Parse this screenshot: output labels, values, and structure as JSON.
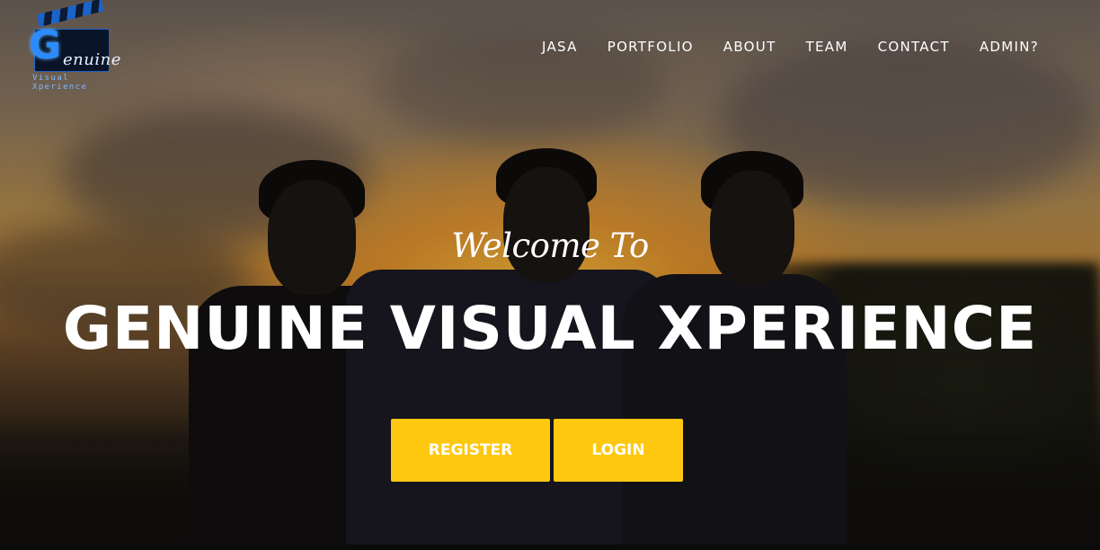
{
  "brand": {
    "logo_letter": "G",
    "logo_word": "enuine",
    "logo_subtitle": "Visual Xperience"
  },
  "nav": {
    "items": [
      {
        "label": "JASA"
      },
      {
        "label": "PORTFOLIO"
      },
      {
        "label": "ABOUT"
      },
      {
        "label": "TEAM"
      },
      {
        "label": "CONTACT"
      },
      {
        "label": "ADMIN?"
      }
    ]
  },
  "hero": {
    "welcome": "Welcome To",
    "headline": "GENUINE VISUAL XPERIENCE",
    "register_label": "REGISTER",
    "login_label": "LOGIN"
  },
  "colors": {
    "accent": "#fec810",
    "text": "#ffffff",
    "logo_blue": "#2a8cff"
  }
}
